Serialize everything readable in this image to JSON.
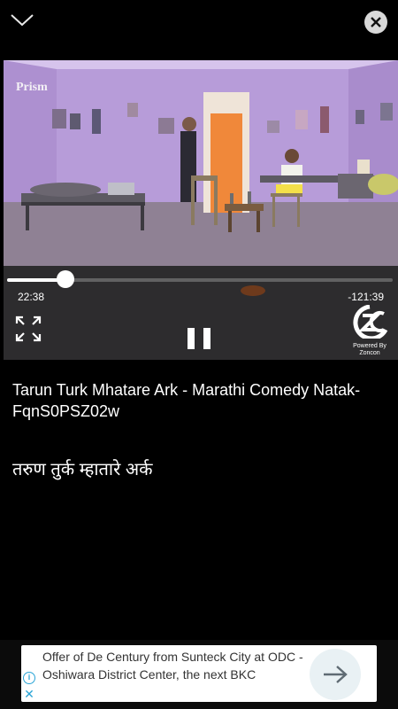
{
  "header": {
    "collapse_icon": "chevron-down-icon",
    "close_icon": "close-icon"
  },
  "player": {
    "watermark": "Prism",
    "elapsed": "22:38",
    "remaining": "-121:39",
    "progress_fraction": 0.152,
    "brand": {
      "logo_text": "ZC",
      "caption_line1": "Powered By",
      "caption_line2": "Zoncon"
    },
    "controls": {
      "fullscreen_icon": "fullscreen-icon",
      "pause_icon": "pause-icon"
    }
  },
  "video": {
    "title_en": "Tarun Turk Mhatare Ark - Marathi Comedy Natak-FqnS0PSZ02w",
    "title_mr": "तरुण तुर्क म्हातारे अर्क"
  },
  "ad": {
    "text": "Offer of De Century from Sunteck City at ODC - Oshiwara District Center, the next BKC",
    "info_glyph": "i",
    "close_glyph": "✕",
    "arrow_icon": "arrow-right-icon",
    "accent": "#2aa4d6"
  }
}
